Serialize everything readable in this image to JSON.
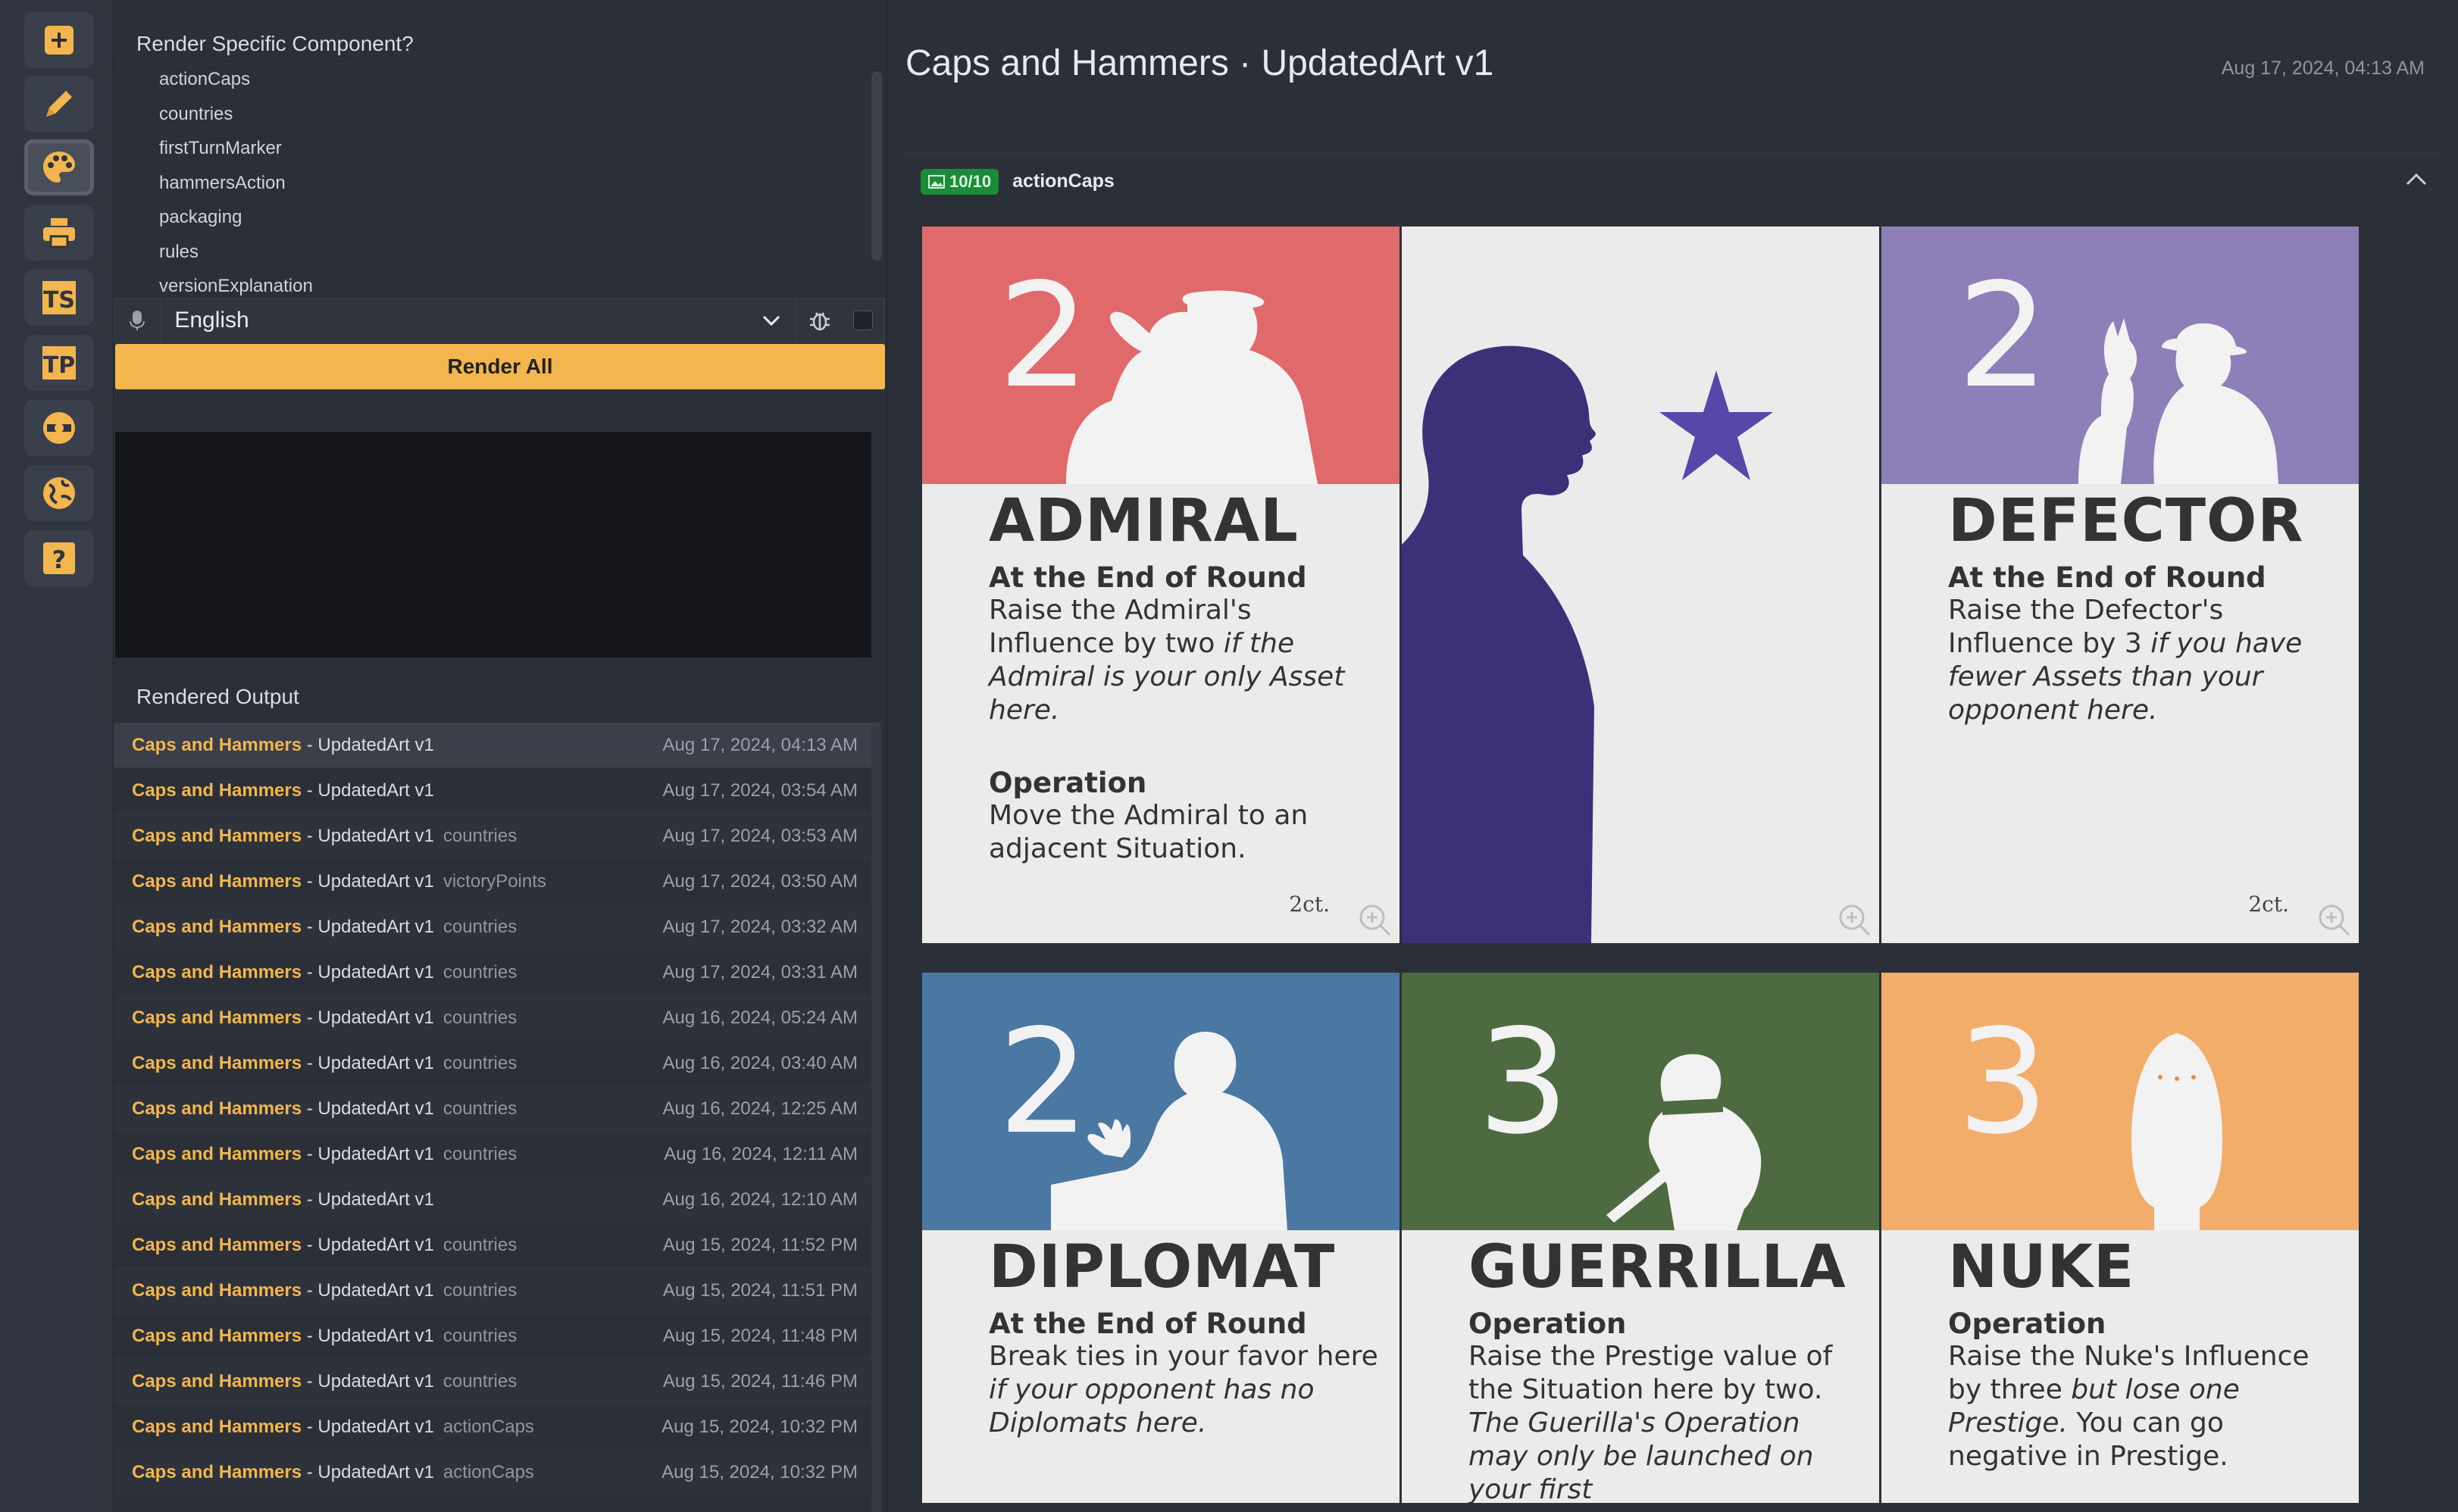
{
  "rail": {
    "items": [
      {
        "icon": "plus-icon",
        "active": false
      },
      {
        "icon": "pencil-icon",
        "active": false
      },
      {
        "icon": "palette-icon",
        "active": true
      },
      {
        "icon": "printer-icon",
        "active": false
      },
      {
        "icon": "ts-logo-icon",
        "label": "TS",
        "active": false
      },
      {
        "icon": "tp-logo-icon",
        "label": "TP",
        "active": false
      },
      {
        "icon": "game-crafter-logo-icon",
        "active": false
      },
      {
        "icon": "globe-icon",
        "active": false
      },
      {
        "icon": "help-icon",
        "label": "?",
        "active": false
      }
    ]
  },
  "components": {
    "title": "Render Specific Component?",
    "items": [
      "actionCaps",
      "countries",
      "firstTurnMarker",
      "hammersAction",
      "packaging",
      "rules",
      "versionExplanation"
    ]
  },
  "language": {
    "selected": "English"
  },
  "render_all_label": "Render All",
  "output": {
    "title": "Rendered Output",
    "rows": [
      {
        "name": "Caps and Hammers",
        "version": "UpdatedArt v1",
        "component": "",
        "time": "Aug 17, 2024, 04:13 AM",
        "selected": true
      },
      {
        "name": "Caps and Hammers",
        "version": "UpdatedArt v1",
        "component": "",
        "time": "Aug 17, 2024, 03:54 AM"
      },
      {
        "name": "Caps and Hammers",
        "version": "UpdatedArt v1",
        "component": "countries",
        "time": "Aug 17, 2024, 03:53 AM"
      },
      {
        "name": "Caps and Hammers",
        "version": "UpdatedArt v1",
        "component": "victoryPoints",
        "time": "Aug 17, 2024, 03:50 AM"
      },
      {
        "name": "Caps and Hammers",
        "version": "UpdatedArt v1",
        "component": "countries",
        "time": "Aug 17, 2024, 03:32 AM"
      },
      {
        "name": "Caps and Hammers",
        "version": "UpdatedArt v1",
        "component": "countries",
        "time": "Aug 17, 2024, 03:31 AM"
      },
      {
        "name": "Caps and Hammers",
        "version": "UpdatedArt v1",
        "component": "countries",
        "time": "Aug 16, 2024, 05:24 AM"
      },
      {
        "name": "Caps and Hammers",
        "version": "UpdatedArt v1",
        "component": "countries",
        "time": "Aug 16, 2024, 03:40 AM"
      },
      {
        "name": "Caps and Hammers",
        "version": "UpdatedArt v1",
        "component": "countries",
        "time": "Aug 16, 2024, 12:25 AM"
      },
      {
        "name": "Caps and Hammers",
        "version": "UpdatedArt v1",
        "component": "countries",
        "time": "Aug 16, 2024, 12:11 AM"
      },
      {
        "name": "Caps and Hammers",
        "version": "UpdatedArt v1",
        "component": "",
        "time": "Aug 16, 2024, 12:10 AM"
      },
      {
        "name": "Caps and Hammers",
        "version": "UpdatedArt v1",
        "component": "countries",
        "time": "Aug 15, 2024, 11:52 PM"
      },
      {
        "name": "Caps and Hammers",
        "version": "UpdatedArt v1",
        "component": "countries",
        "time": "Aug 15, 2024, 11:51 PM"
      },
      {
        "name": "Caps and Hammers",
        "version": "UpdatedArt v1",
        "component": "countries",
        "time": "Aug 15, 2024, 11:48 PM"
      },
      {
        "name": "Caps and Hammers",
        "version": "UpdatedArt v1",
        "component": "countries",
        "time": "Aug 15, 2024, 11:46 PM"
      },
      {
        "name": "Caps and Hammers",
        "version": "UpdatedArt v1",
        "component": "actionCaps",
        "time": "Aug 15, 2024, 10:32 PM"
      },
      {
        "name": "Caps and Hammers",
        "version": "UpdatedArt v1",
        "component": "actionCaps",
        "time": "Aug 15, 2024, 10:32 PM"
      }
    ]
  },
  "main": {
    "title": "Caps and Hammers · UpdatedArt v1",
    "date": "Aug 17, 2024, 04:13 AM",
    "section": {
      "badge": "10/10",
      "name": "actionCaps"
    }
  },
  "cards": [
    {
      "id": "admiral",
      "color": "#e06a6b",
      "number": "2",
      "name": "ADMIRAL",
      "lines": [
        {
          "t": "hdr",
          "text": "At the End of Round"
        },
        {
          "t": "txt",
          "parts": [
            {
              "s": "Raise the Admiral's Influence by two "
            },
            {
              "s": "if the Admiral is your only Asset here.",
              "i": true
            }
          ]
        },
        {
          "t": "gap"
        },
        {
          "t": "hdr",
          "text": "Operation"
        },
        {
          "t": "txt",
          "parts": [
            {
              "s": "Move the Admiral to an adjacent Situation."
            }
          ]
        }
      ],
      "count": "2ct."
    },
    {
      "id": "art",
      "color": "#ebebeb",
      "art": true
    },
    {
      "id": "defector",
      "color": "#8f7fb8",
      "number": "2",
      "name": "DEFECTOR",
      "lines": [
        {
          "t": "hdr",
          "text": "At the End of Round"
        },
        {
          "t": "txt",
          "parts": [
            {
              "s": "Raise the Defector's Influence by 3 "
            },
            {
              "s": "if you have fewer Assets than your opponent here.",
              "i": true
            }
          ]
        }
      ],
      "count": "2ct."
    },
    {
      "id": "diplomat",
      "color": "#4b77a3",
      "number": "2",
      "name": "DIPLOMAT",
      "lines": [
        {
          "t": "hdr",
          "text": "At the End of Round"
        },
        {
          "t": "txt",
          "parts": [
            {
              "s": "Break ties in your favor here "
            },
            {
              "s": "if your opponent has no Diplomats here.",
              "i": true
            }
          ]
        }
      ]
    },
    {
      "id": "guerrilla",
      "color": "#4d6a40",
      "number": "3",
      "name": "GUERRILLA",
      "lines": [
        {
          "t": "hdr",
          "text": "Operation"
        },
        {
          "t": "txt",
          "parts": [
            {
              "s": "Raise the Prestige value of the Situation here by two. "
            },
            {
              "s": "The Guerilla's Operation may only be launched on your first",
              "i": true
            }
          ]
        }
      ]
    },
    {
      "id": "nuke",
      "color": "#f2ad6b",
      "number": "3",
      "name": "NUKE",
      "lines": [
        {
          "t": "hdr",
          "text": "Operation"
        },
        {
          "t": "txt",
          "parts": [
            {
              "s": "Raise the Nuke's Influence by three "
            },
            {
              "s": "but lose one Prestige.",
              "i": true
            },
            {
              "s": " You can go negative in Prestige."
            }
          ]
        }
      ]
    }
  ],
  "colors": {
    "accent": "#f3b54e",
    "badge": "#1c8c3a",
    "art_figure": "#3b3178",
    "art_star": "#5548a8"
  }
}
